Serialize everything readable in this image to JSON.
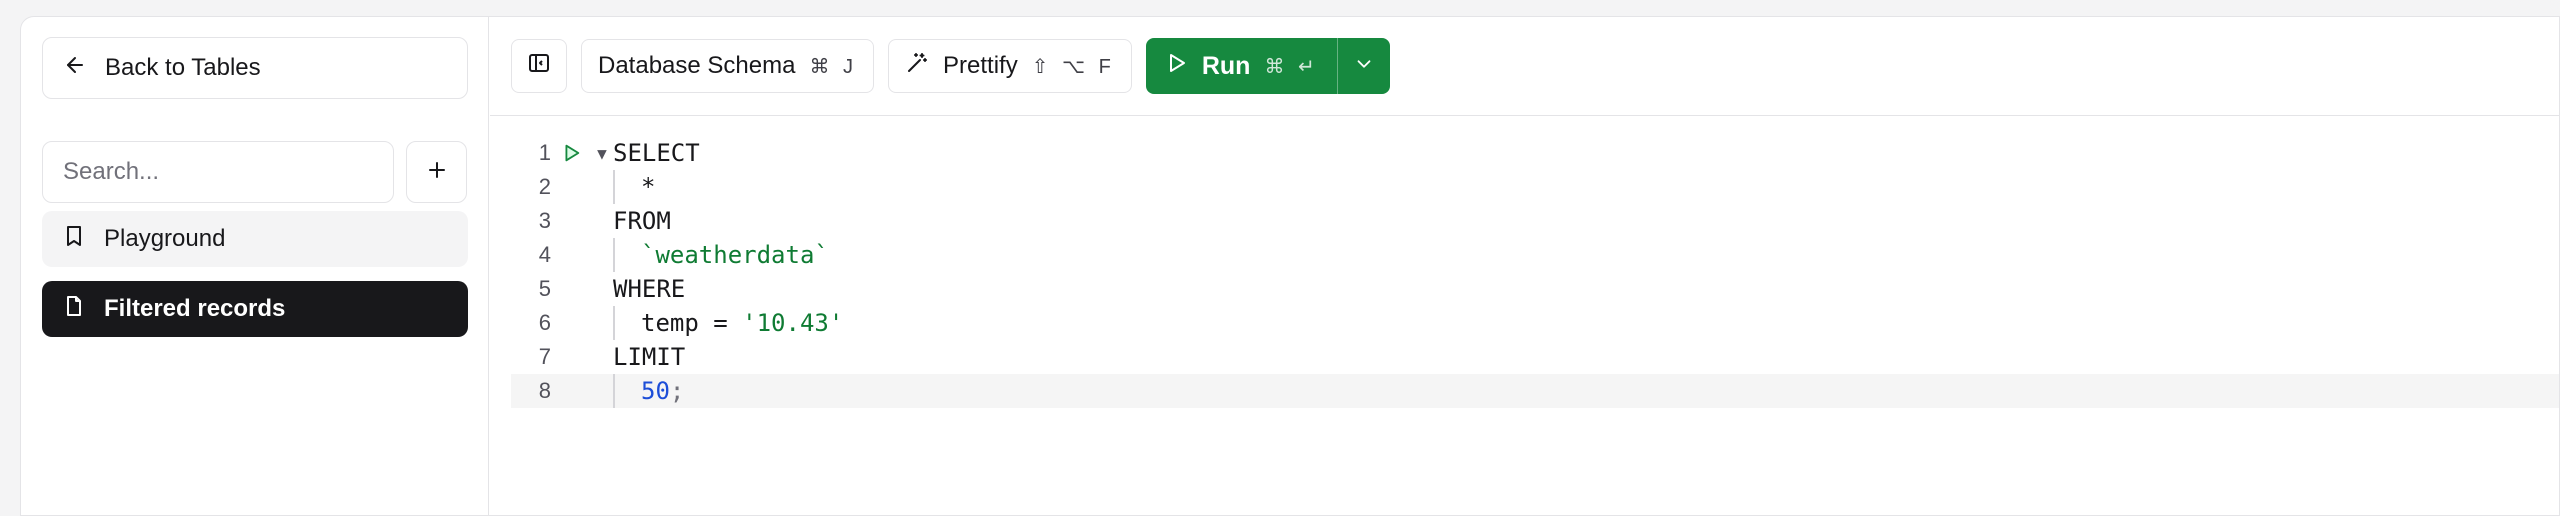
{
  "sidebar": {
    "back_label": "Back to Tables",
    "search_placeholder": "Search...",
    "items": [
      {
        "label": "Playground",
        "icon": "bookmark-icon"
      },
      {
        "label": "Filtered records",
        "icon": "file-icon"
      }
    ]
  },
  "toolbar": {
    "schema_label": "Database Schema",
    "schema_shortcut": "⌘ J",
    "prettify_label": "Prettify",
    "prettify_shortcut": "⇧ ⌥ F",
    "run_label": "Run",
    "run_shortcut": "⌘ ↵"
  },
  "editor": {
    "line_numbers": [
      "1",
      "2",
      "3",
      "4",
      "5",
      "6",
      "7",
      "8"
    ],
    "lines": {
      "l1": "SELECT",
      "l2": "*",
      "l3": "FROM",
      "l4": "`weatherdata`",
      "l5": "WHERE",
      "l6_a": "temp = ",
      "l6_b": "'10.43'",
      "l7": "LIMIT",
      "l8_a": "50",
      "l8_b": ";"
    }
  },
  "colors": {
    "accent_green": "#16893f",
    "active_item_bg": "#18181b",
    "string": "#0f7b33",
    "number": "#1d4ed8"
  }
}
